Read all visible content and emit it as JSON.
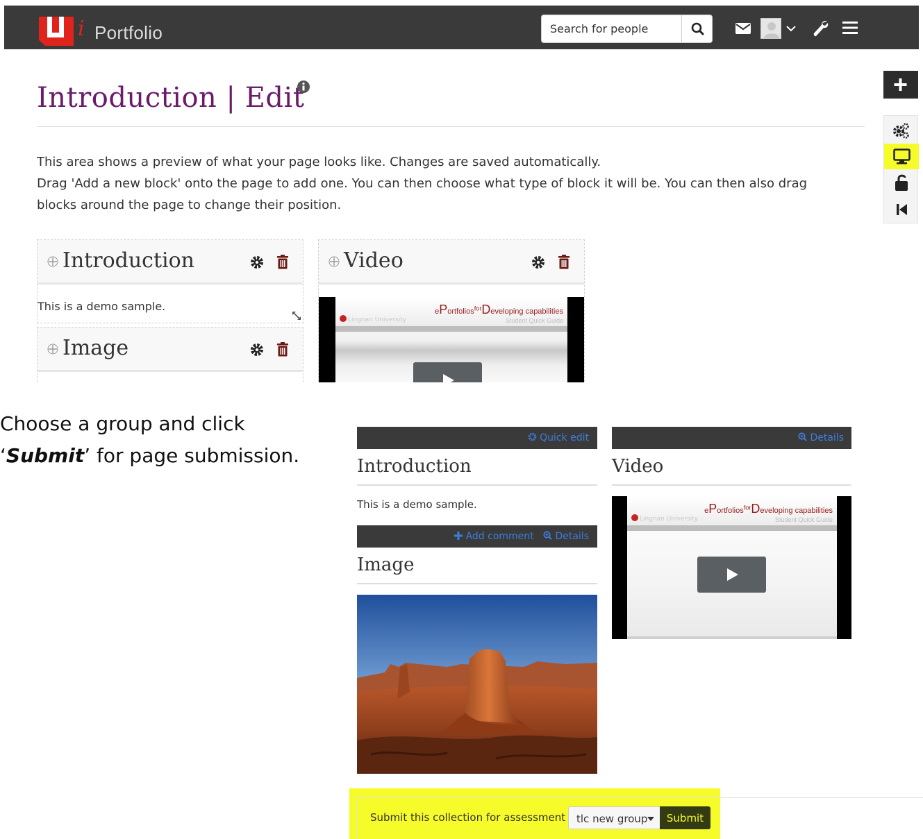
{
  "header": {
    "logo_text": "Portfolio",
    "search_placeholder": "Search for people"
  },
  "page": {
    "title": "Introduction | Edit",
    "description_line1": "This area shows a preview of what your page looks like. Changes are saved automatically.",
    "description_line2": "Drag 'Add a new block' onto the page to add one. You can then choose what type of block it will be. You can then also drag blocks around the page to change their position."
  },
  "edit_blocks": {
    "introduction": {
      "title": "Introduction",
      "body": "This is a demo sample."
    },
    "image": {
      "title": "Image"
    },
    "video": {
      "title": "Video"
    }
  },
  "annotation": {
    "line1": "Choose a group and click",
    "line2_prefix": "‘",
    "line2_bold": "Submit",
    "line2_suffix": "’ for page submission."
  },
  "preview": {
    "introduction": {
      "action": "Quick edit",
      "title": "Introduction",
      "body": "This is a demo sample."
    },
    "video": {
      "action": "Details",
      "title": "Video"
    },
    "image": {
      "action_comment": "Add comment",
      "action_details": "Details",
      "title": "Image"
    }
  },
  "video_thumb": {
    "brand_prefix": "e",
    "brand_p": "P",
    "brand_ortfolios": "ortfolios",
    "brand_for": "for",
    "brand_d": "D",
    "brand_eveloping": "eveloping capabilities",
    "brand_student": "Student",
    "brand_guide": "Student Quick Guide",
    "uni_name": "Lingnan University"
  },
  "submission": {
    "label": "Submit this collection for assessment to",
    "selected_group": "tlc new group",
    "button": "Submit"
  },
  "colors": {
    "highlight": "#f6fb2a",
    "title_purple": "#6a1b6a",
    "link_blue": "#3c7dd9",
    "topbar": "#3a3a3a"
  }
}
